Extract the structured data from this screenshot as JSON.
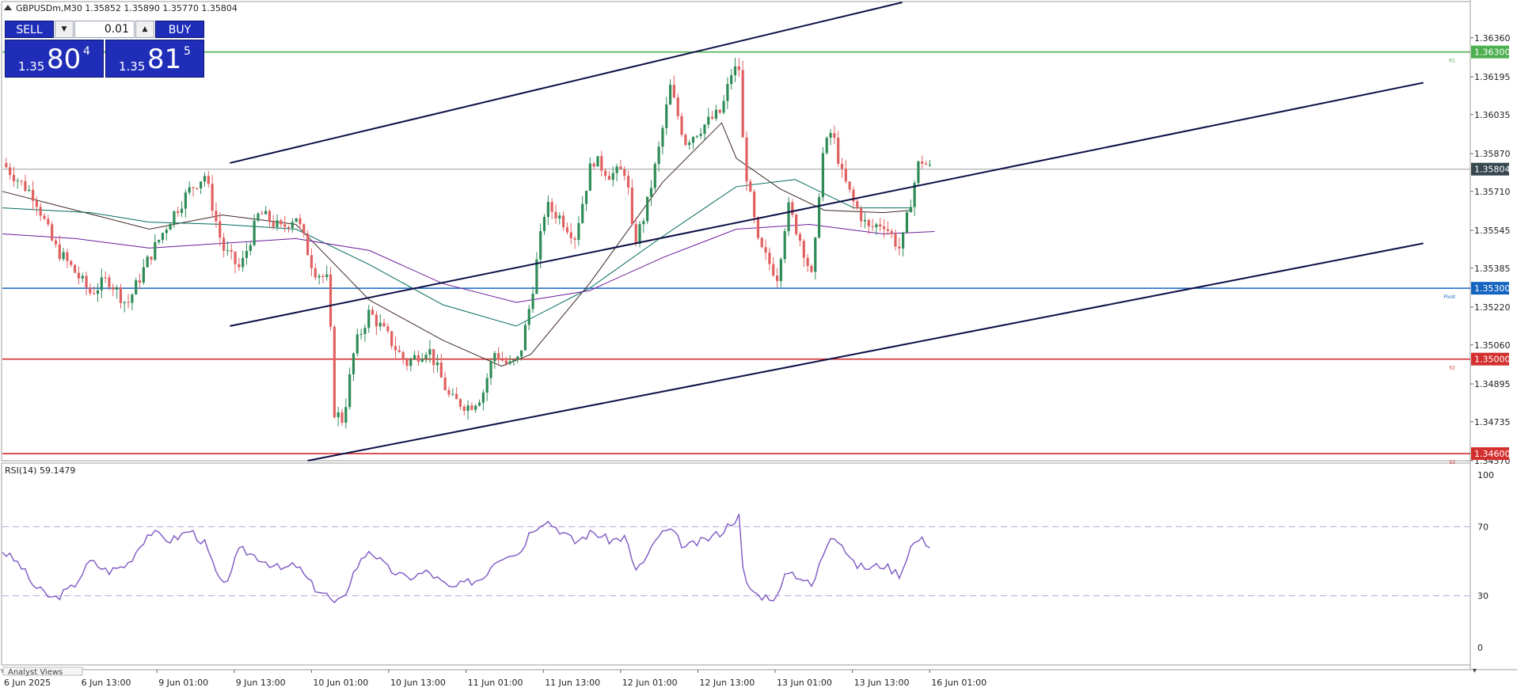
{
  "window": {
    "header": "GBPUSDm,M30  1.35852 1.35890 1.35770 1.35804",
    "arrow_icon": "triangle-up-icon"
  },
  "trade_panel": {
    "sell_label": "SELL",
    "buy_label": "BUY",
    "lot": "0.01",
    "bid": {
      "prefix": "1.35",
      "big": "80",
      "point": "4"
    },
    "ask": {
      "prefix": "1.35",
      "big": "81",
      "point": "5"
    }
  },
  "colors": {
    "bull": "#2e8b57",
    "bear": "#e06060",
    "channel": "#0d1046",
    "r1": "#4caf50",
    "pivot": "#1565c0",
    "support": "#d32f2f",
    "current_tag": "#37474f",
    "rsi": "#7e57c2",
    "ma_fast": "#3e2723",
    "ma_mid": "#00695c",
    "ma_slow": "#6a1b9a"
  },
  "chart_data": [
    {
      "type": "candlestick",
      "symbol": "GBPUSDm",
      "timeframe": "M30",
      "ohlc_header": {
        "open": 1.35852,
        "high": 1.3589,
        "low": 1.3577,
        "close": 1.35804
      },
      "ylim": [
        1.3457,
        1.3652
      ],
      "y_ticks": [
        "1.36360",
        "1.36195",
        "1.36035",
        "1.35870",
        "1.35710",
        "1.35545",
        "1.35385",
        "1.35220",
        "1.35060",
        "1.34895",
        "1.34735",
        "1.34570"
      ],
      "x_ticks": [
        "6 Jun 2025",
        "6 Jun 13:00",
        "9 Jun 01:00",
        "9 Jun 13:00",
        "10 Jun 01:00",
        "10 Jun 13:00",
        "11 Jun 01:00",
        "11 Jun 13:00",
        "12 Jun 01:00",
        "12 Jun 13:00",
        "13 Jun 01:00",
        "13 Jun 13:00",
        "16 Jun 01:00"
      ],
      "current_price": "1.35804",
      "levels": [
        {
          "price": 1.363,
          "tag": "1.36300",
          "label": "R1",
          "color": "r1"
        },
        {
          "price": 1.353,
          "tag": "1.35300",
          "label": "Pivot",
          "color": "pivot"
        },
        {
          "price": 1.35,
          "tag": "1.35000",
          "label": "S2",
          "color": "support"
        },
        {
          "price": 1.346,
          "tag": "1.34600",
          "label": "S3",
          "color": "support"
        }
      ],
      "channel_lines": [
        {
          "x": [
            0.155,
            0.613
          ],
          "y": [
            1.3583,
            1.3651
          ]
        },
        {
          "x": [
            0.155,
            0.968
          ],
          "y": [
            1.3514,
            1.3617
          ]
        },
        {
          "x": [
            0.208,
            0.968
          ],
          "y": [
            1.3457,
            1.3549
          ]
        }
      ],
      "close_path": [
        [
          0,
          1.3583
        ],
        [
          0.012,
          1.3575
        ],
        [
          0.022,
          1.3569
        ],
        [
          0.035,
          1.3548
        ],
        [
          0.048,
          1.3538
        ],
        [
          0.06,
          1.3528
        ],
        [
          0.072,
          1.3534
        ],
        [
          0.085,
          1.3523
        ],
        [
          0.1,
          1.3543
        ],
        [
          0.115,
          1.356
        ],
        [
          0.128,
          1.3572
        ],
        [
          0.138,
          1.3578
        ],
        [
          0.15,
          1.3547
        ],
        [
          0.162,
          1.3538
        ],
        [
          0.175,
          1.3562
        ],
        [
          0.19,
          1.3555
        ],
        [
          0.2,
          1.3561
        ],
        [
          0.212,
          1.3538
        ],
        [
          0.222,
          1.3533
        ],
        [
          0.226,
          1.3478
        ],
        [
          0.232,
          1.3474
        ],
        [
          0.24,
          1.3505
        ],
        [
          0.25,
          1.352
        ],
        [
          0.262,
          1.351
        ],
        [
          0.275,
          1.3498
        ],
        [
          0.29,
          1.3505
        ],
        [
          0.305,
          1.3483
        ],
        [
          0.318,
          1.348
        ],
        [
          0.327,
          1.3485
        ],
        [
          0.335,
          1.3503
        ],
        [
          0.345,
          1.3497
        ],
        [
          0.352,
          1.35
        ],
        [
          0.36,
          1.3525
        ],
        [
          0.37,
          1.3565
        ],
        [
          0.38,
          1.356
        ],
        [
          0.39,
          1.3552
        ],
        [
          0.402,
          1.3585
        ],
        [
          0.414,
          1.3578
        ],
        [
          0.425,
          1.358
        ],
        [
          0.43,
          1.3548
        ],
        [
          0.438,
          1.3562
        ],
        [
          0.447,
          1.3588
        ],
        [
          0.455,
          1.3615
        ],
        [
          0.465,
          1.3592
        ],
        [
          0.478,
          1.3599
        ],
        [
          0.49,
          1.3605
        ],
        [
          0.497,
          1.3622
        ],
        [
          0.502,
          1.3623
        ],
        [
          0.505,
          1.3585
        ],
        [
          0.515,
          1.3548
        ],
        [
          0.528,
          1.3535
        ],
        [
          0.535,
          1.3565
        ],
        [
          0.545,
          1.3548
        ],
        [
          0.552,
          1.3533
        ],
        [
          0.558,
          1.3585
        ],
        [
          0.565,
          1.3597
        ],
        [
          0.572,
          1.3578
        ],
        [
          0.58,
          1.3566
        ],
        [
          0.59,
          1.3555
        ],
        [
          0.6,
          1.3558
        ],
        [
          0.612,
          1.3546
        ],
        [
          0.618,
          1.3565
        ],
        [
          0.625,
          1.3585
        ],
        [
          0.633,
          1.358
        ]
      ],
      "moving_averages": [
        {
          "color": "ma_fast",
          "points": [
            [
              0,
              1.3571
            ],
            [
              0.05,
              1.3563
            ],
            [
              0.1,
              1.3555
            ],
            [
              0.15,
              1.3561
            ],
            [
              0.2,
              1.3557
            ],
            [
              0.25,
              1.3525
            ],
            [
              0.3,
              1.3508
            ],
            [
              0.34,
              1.3497
            ],
            [
              0.36,
              1.3502
            ],
            [
              0.4,
              1.3532
            ],
            [
              0.45,
              1.3575
            ],
            [
              0.49,
              1.36
            ],
            [
              0.5,
              1.3585
            ],
            [
              0.53,
              1.3572
            ],
            [
              0.56,
              1.3563
            ],
            [
              0.6,
              1.3562
            ],
            [
              0.62,
              1.3563
            ]
          ]
        },
        {
          "color": "ma_mid",
          "points": [
            [
              0,
              1.3564
            ],
            [
              0.06,
              1.3562
            ],
            [
              0.1,
              1.3558
            ],
            [
              0.15,
              1.3557
            ],
            [
              0.2,
              1.3555
            ],
            [
              0.25,
              1.354
            ],
            [
              0.3,
              1.3523
            ],
            [
              0.35,
              1.3514
            ],
            [
              0.4,
              1.353
            ],
            [
              0.45,
              1.3552
            ],
            [
              0.5,
              1.3573
            ],
            [
              0.54,
              1.3576
            ],
            [
              0.58,
              1.3564
            ],
            [
              0.62,
              1.3564
            ]
          ]
        },
        {
          "color": "ma_slow",
          "points": [
            [
              0,
              1.3553
            ],
            [
              0.05,
              1.3551
            ],
            [
              0.1,
              1.3547
            ],
            [
              0.15,
              1.3549
            ],
            [
              0.2,
              1.3551
            ],
            [
              0.25,
              1.3546
            ],
            [
              0.3,
              1.3532
            ],
            [
              0.35,
              1.3524
            ],
            [
              0.4,
              1.3529
            ],
            [
              0.45,
              1.3543
            ],
            [
              0.5,
              1.3555
            ],
            [
              0.55,
              1.3557
            ],
            [
              0.6,
              1.3553
            ],
            [
              0.635,
              1.3554
            ]
          ]
        }
      ]
    },
    {
      "type": "line",
      "indicator": "RSI(14)",
      "label": "RSI(14) 59.1479",
      "value": 59.1479,
      "ylim": [
        0,
        100
      ],
      "y_ticks": [
        "100",
        "70",
        "30",
        "0"
      ],
      "levels": [
        70,
        30
      ],
      "points": [
        [
          0,
          56
        ],
        [
          0.012,
          48
        ],
        [
          0.022,
          35
        ],
        [
          0.035,
          28
        ],
        [
          0.048,
          35
        ],
        [
          0.06,
          50
        ],
        [
          0.072,
          44
        ],
        [
          0.085,
          48
        ],
        [
          0.1,
          67
        ],
        [
          0.115,
          62
        ],
        [
          0.128,
          68
        ],
        [
          0.138,
          60
        ],
        [
          0.15,
          34
        ],
        [
          0.162,
          57
        ],
        [
          0.175,
          52
        ],
        [
          0.19,
          45
        ],
        [
          0.2,
          48
        ],
        [
          0.212,
          35
        ],
        [
          0.222,
          30
        ],
        [
          0.226,
          25
        ],
        [
          0.232,
          28
        ],
        [
          0.24,
          45
        ],
        [
          0.25,
          57
        ],
        [
          0.262,
          46
        ],
        [
          0.275,
          40
        ],
        [
          0.29,
          44
        ],
        [
          0.305,
          34
        ],
        [
          0.318,
          38
        ],
        [
          0.327,
          40
        ],
        [
          0.335,
          50
        ],
        [
          0.345,
          55
        ],
        [
          0.352,
          54
        ],
        [
          0.36,
          68
        ],
        [
          0.37,
          74
        ],
        [
          0.38,
          68
        ],
        [
          0.39,
          61
        ],
        [
          0.402,
          67
        ],
        [
          0.414,
          62
        ],
        [
          0.425,
          64
        ],
        [
          0.43,
          45
        ],
        [
          0.438,
          50
        ],
        [
          0.447,
          65
        ],
        [
          0.455,
          68
        ],
        [
          0.465,
          58
        ],
        [
          0.478,
          62
        ],
        [
          0.49,
          67
        ],
        [
          0.497,
          73
        ],
        [
          0.502,
          76
        ],
        [
          0.505,
          38
        ],
        [
          0.515,
          30
        ],
        [
          0.528,
          29
        ],
        [
          0.535,
          45
        ],
        [
          0.545,
          40
        ],
        [
          0.552,
          35
        ],
        [
          0.558,
          52
        ],
        [
          0.565,
          67
        ],
        [
          0.572,
          60
        ],
        [
          0.58,
          48
        ],
        [
          0.59,
          46
        ],
        [
          0.6,
          48
        ],
        [
          0.612,
          42
        ],
        [
          0.618,
          58
        ],
        [
          0.625,
          63
        ],
        [
          0.633,
          59.1
        ]
      ]
    }
  ],
  "bottom_tab": "Analyst Views"
}
